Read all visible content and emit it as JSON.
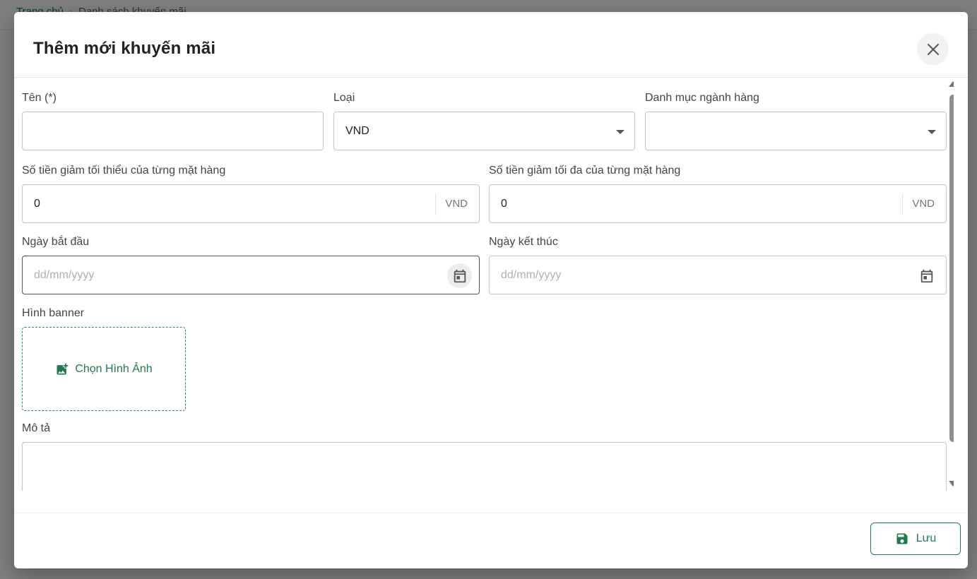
{
  "background": {
    "breadcrumb": {
      "home": "Trang chủ",
      "separator": "›",
      "current": "Danh sách khuyến mãi"
    }
  },
  "dialog": {
    "title": "Thêm mới khuyến mãi",
    "close_icon": "close-icon"
  },
  "form": {
    "name": {
      "label": "Tên (*)",
      "value": ""
    },
    "type": {
      "label": "Loại",
      "value": "VND"
    },
    "category": {
      "label": "Danh mục ngành hàng",
      "value": ""
    },
    "min_discount": {
      "label": "Số tiền giảm tối thiểu của từng mặt hàng",
      "value": "0",
      "unit": "VND"
    },
    "max_discount": {
      "label": "Số tiền giảm tối đa của từng mặt hàng",
      "value": "0",
      "unit": "VND"
    },
    "start_date": {
      "label": "Ngày bắt đầu",
      "placeholder": "dd/mm/yyyy"
    },
    "end_date": {
      "label": "Ngày kết thúc",
      "placeholder": "dd/mm/yyyy"
    },
    "banner": {
      "label": "Hình banner",
      "button_label": "Chọn Hình Ảnh"
    },
    "description": {
      "label": "Mô tả",
      "value": ""
    }
  },
  "footer": {
    "save_label": "Lưu"
  },
  "colors": {
    "accent": "#1f7a4d",
    "border": "#c4c4c4",
    "overlay": "rgba(0,0,0,0.5)"
  }
}
